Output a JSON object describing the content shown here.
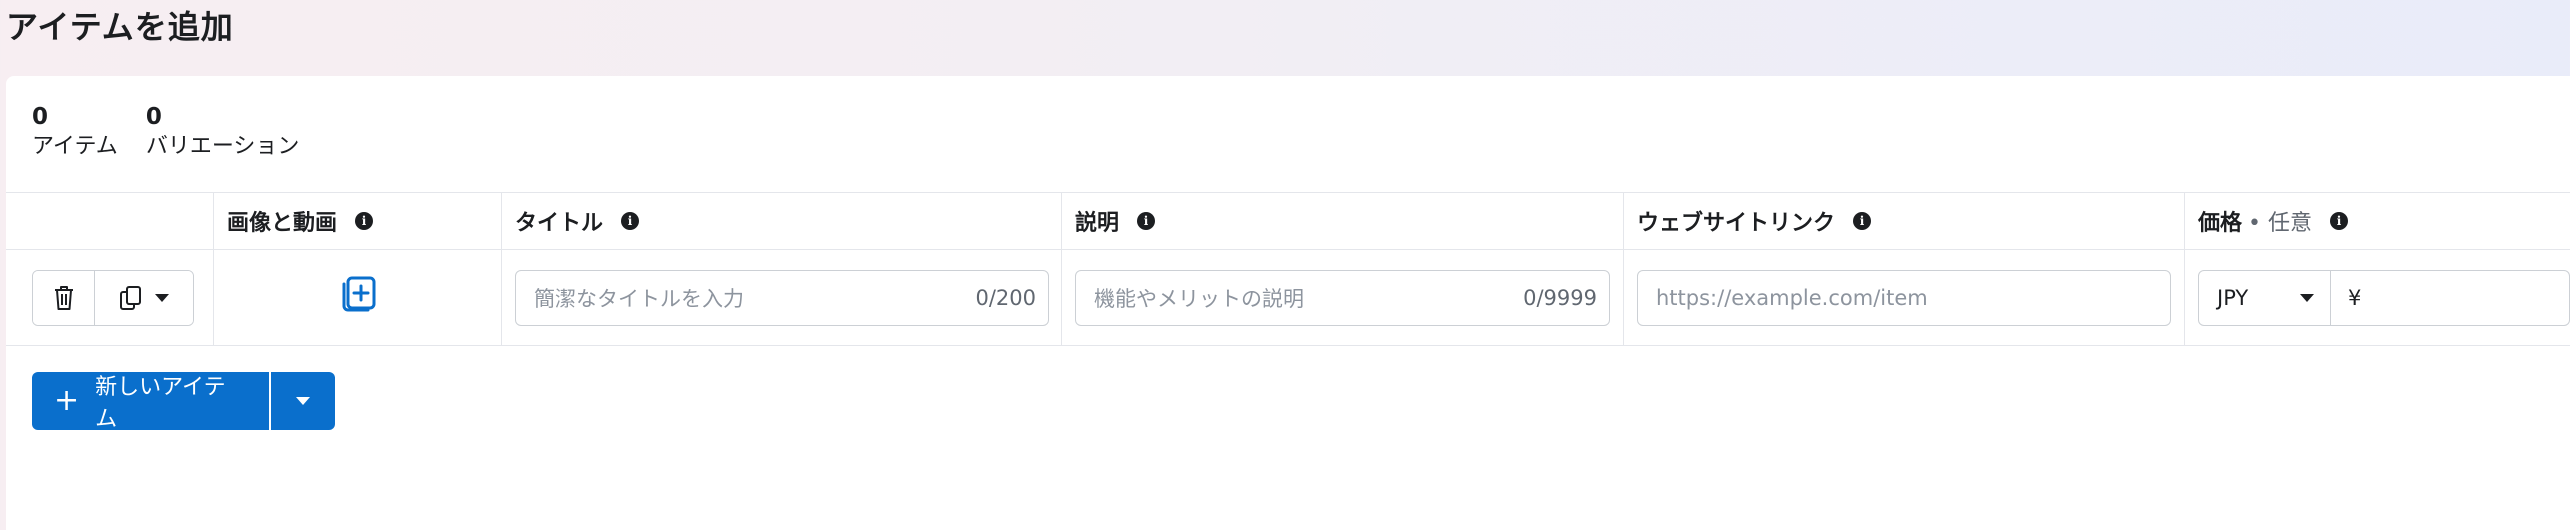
{
  "page": {
    "title": "アイテムを追加"
  },
  "counts": {
    "items": {
      "value": "0",
      "label": "アイテム"
    },
    "variations": {
      "value": "0",
      "label": "バリエーション"
    }
  },
  "table": {
    "headers": {
      "media": "画像と動画",
      "title": "タイトル",
      "description": "説明",
      "website": "ウェブサイトリンク",
      "price": "価格",
      "price_optional": "• 任意"
    },
    "row": {
      "title_placeholder": "簡潔なタイトルを入力",
      "title_counter": "0/200",
      "description_placeholder": "機能やメリットの説明",
      "description_counter": "0/9999",
      "url_placeholder": "https://example.com/item",
      "currency": "JPY",
      "currency_symbol": "¥"
    }
  },
  "actions": {
    "new_item": "新しいアイテム"
  },
  "colors": {
    "accent": "#0a6fcc",
    "border": "#ccd0d5"
  },
  "icons": [
    "info-icon",
    "trash-icon",
    "duplicate-icon",
    "chevron-down-icon",
    "add-media-icon",
    "plus-icon"
  ]
}
